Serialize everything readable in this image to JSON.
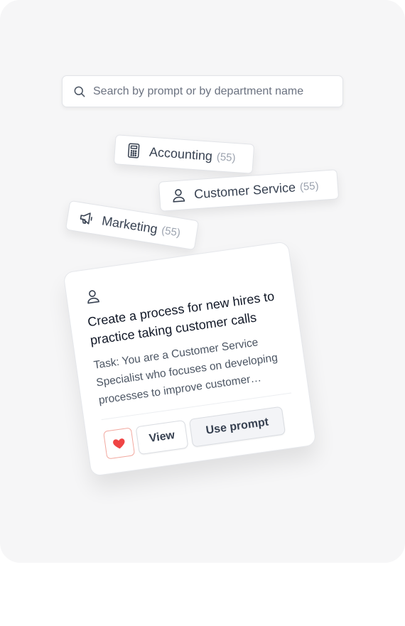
{
  "search": {
    "placeholder": "Search by prompt or by department name",
    "icon": "search-icon"
  },
  "departments": [
    {
      "label": "Accounting",
      "count": "(55)",
      "icon": "calculator-icon"
    },
    {
      "label": "Customer Service",
      "count": "(55)",
      "icon": "person-icon"
    },
    {
      "label": "Marketing",
      "count": "(55)",
      "icon": "megaphone-icon"
    }
  ],
  "prompt_card": {
    "icon": "person-icon",
    "title": "Create a process for new hires to practice taking customer calls",
    "task": "Task: You are a Customer Service Specialist who focuses on developing processes to improve customer satisfaction",
    "favorite_icon": "heart-icon",
    "view_label": "View",
    "use_label": "Use prompt"
  },
  "colors": {
    "heart": "#ef4444",
    "heart_border": "#f2a89f",
    "panel_bg": "#f6f6f7"
  }
}
